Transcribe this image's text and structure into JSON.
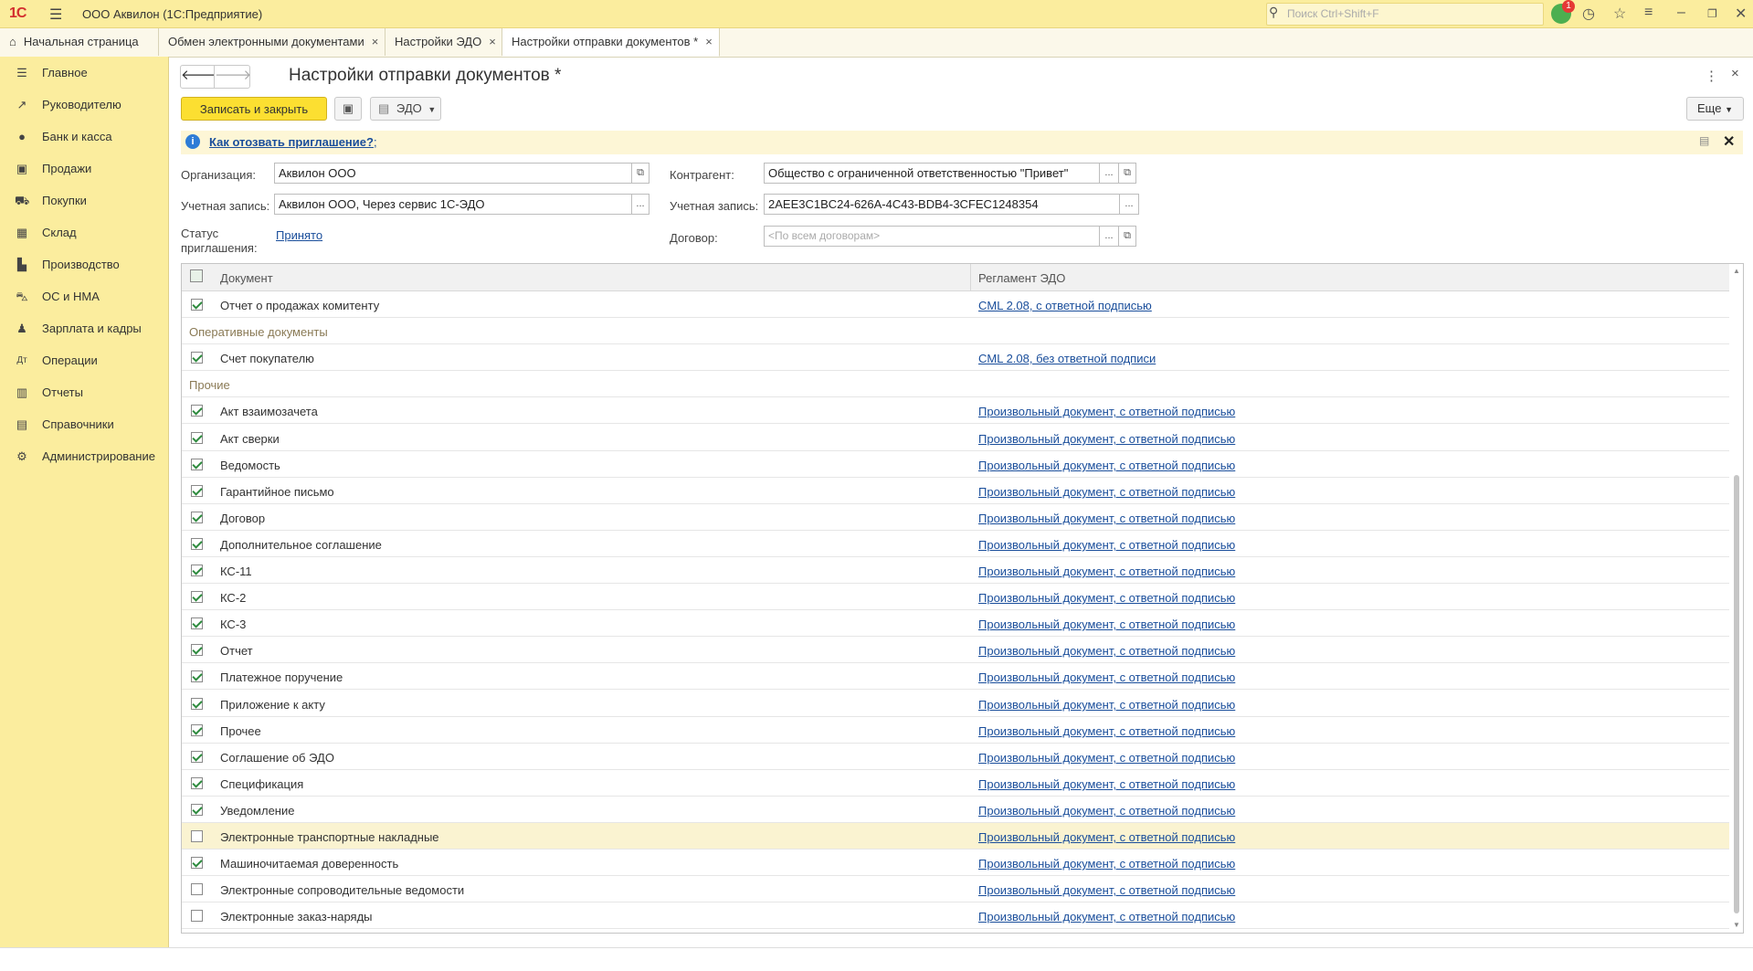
{
  "app": {
    "logo": "1С",
    "title": "ООО Аквилон  (1С:Предприятие)",
    "search_placeholder": "Поиск Ctrl+Shift+F",
    "notifications_count": "1"
  },
  "tabs": [
    {
      "label": "Начальная страница",
      "closable": false
    },
    {
      "label": "Обмен электронными документами",
      "closable": true
    },
    {
      "label": "Настройки ЭДО",
      "closable": true
    },
    {
      "label": "Настройки отправки документов *",
      "closable": true,
      "active": true
    }
  ],
  "sidebar": {
    "items": [
      {
        "label": "Главное",
        "icon": "menu-icon"
      },
      {
        "label": "Руководителю",
        "icon": "trend-icon"
      },
      {
        "label": "Банк и касса",
        "icon": "coin-icon"
      },
      {
        "label": "Продажи",
        "icon": "bag-icon"
      },
      {
        "label": "Покупки",
        "icon": "cart-icon"
      },
      {
        "label": "Склад",
        "icon": "grid-icon"
      },
      {
        "label": "Производство",
        "icon": "factory-icon"
      },
      {
        "label": "ОС и НМА",
        "icon": "truck-icon"
      },
      {
        "label": "Зарплата и кадры",
        "icon": "person-icon"
      },
      {
        "label": "Операции",
        "icon": "operations-icon"
      },
      {
        "label": "Отчеты",
        "icon": "bar-chart-icon"
      },
      {
        "label": "Справочники",
        "icon": "book-icon"
      },
      {
        "label": "Администрирование",
        "icon": "gear-icon"
      }
    ]
  },
  "form": {
    "title": "Настройки отправки документов *",
    "save_close_label": "Записать и закрыть",
    "edo_label": "ЭДО",
    "more_label": "Еще",
    "info_link": "Как отозвать приглашение?",
    "info_suffix": ";",
    "org_label": "Организация:",
    "org_value": "Аквилон ООО",
    "account_label": "Учетная запись:",
    "account_value": "Аквилон ООО, Через сервис 1С-ЭДО",
    "status_label_1": "Статус",
    "status_label_2": "приглашения:",
    "status_value": "Принято",
    "counterparty_label": "Контрагент:",
    "counterparty_value": "Общество с ограниченной ответственностью \"Привет\"",
    "cp_account_label": "Учетная запись:",
    "cp_account_value": "2AEE3C1BC24-626A-4C43-BDB4-3CFEC1248354",
    "contract_label": "Договор:",
    "contract_placeholder": "<По всем договорам>",
    "ellipsis": "...",
    "open_icon": "⧉"
  },
  "table": {
    "col_document": "Документ",
    "col_reglament": "Регламент ЭДО",
    "rows": [
      {
        "type": "item",
        "checked": true,
        "name": "Отчет о продажах комитенту",
        "reglament": "CML 2.08, с ответной подписью"
      },
      {
        "type": "group",
        "name": "Оперативные документы"
      },
      {
        "type": "item",
        "checked": true,
        "name": "Счет покупателю",
        "reglament": "CML 2.08, без ответной подписи"
      },
      {
        "type": "group",
        "name": "Прочие"
      },
      {
        "type": "item",
        "checked": true,
        "name": "Акт взаимозачета",
        "reglament": "Произвольный документ, с ответной подписью"
      },
      {
        "type": "item",
        "checked": true,
        "name": "Акт сверки",
        "reglament": "Произвольный документ, с ответной подписью"
      },
      {
        "type": "item",
        "checked": true,
        "name": "Ведомость",
        "reglament": "Произвольный документ, с ответной подписью"
      },
      {
        "type": "item",
        "checked": true,
        "name": "Гарантийное письмо",
        "reglament": "Произвольный документ, с ответной подписью"
      },
      {
        "type": "item",
        "checked": true,
        "name": "Договор",
        "reglament": "Произвольный документ, с ответной подписью"
      },
      {
        "type": "item",
        "checked": true,
        "name": "Дополнительное соглашение",
        "reglament": "Произвольный документ, с ответной подписью"
      },
      {
        "type": "item",
        "checked": true,
        "name": "КС-11",
        "reglament": "Произвольный документ, с ответной подписью"
      },
      {
        "type": "item",
        "checked": true,
        "name": "КС-2",
        "reglament": "Произвольный документ, с ответной подписью"
      },
      {
        "type": "item",
        "checked": true,
        "name": "КС-3",
        "reglament": "Произвольный документ, с ответной подписью"
      },
      {
        "type": "item",
        "checked": true,
        "name": "Отчет",
        "reglament": "Произвольный документ, с ответной подписью"
      },
      {
        "type": "item",
        "checked": true,
        "name": "Платежное поручение",
        "reglament": "Произвольный документ, с ответной подписью"
      },
      {
        "type": "item",
        "checked": true,
        "name": "Приложение к акту",
        "reglament": "Произвольный документ, с ответной подписью"
      },
      {
        "type": "item",
        "checked": true,
        "name": "Прочее",
        "reglament": "Произвольный документ, с ответной подписью"
      },
      {
        "type": "item",
        "checked": true,
        "name": "Соглашение об ЭДО",
        "reglament": "Произвольный документ, с ответной подписью"
      },
      {
        "type": "item",
        "checked": true,
        "name": "Спецификация",
        "reglament": "Произвольный документ, с ответной подписью"
      },
      {
        "type": "item",
        "checked": true,
        "name": "Уведомление",
        "reglament": "Произвольный документ, с ответной подписью"
      },
      {
        "type": "item",
        "checked": false,
        "highlight": true,
        "name": "Электронные транспортные накладные",
        "reglament": "Произвольный документ, с ответной подписью"
      },
      {
        "type": "item",
        "checked": true,
        "name": "Машиночитаемая доверенность",
        "reglament": "Произвольный документ, с ответной подписью"
      },
      {
        "type": "item",
        "checked": false,
        "name": "Электронные сопроводительные ведомости",
        "reglament": "Произвольный документ, с ответной подписью"
      },
      {
        "type": "item",
        "checked": false,
        "name": "Электронные заказ-наряды",
        "reglament": "Произвольный документ, с ответной подписью"
      }
    ]
  }
}
